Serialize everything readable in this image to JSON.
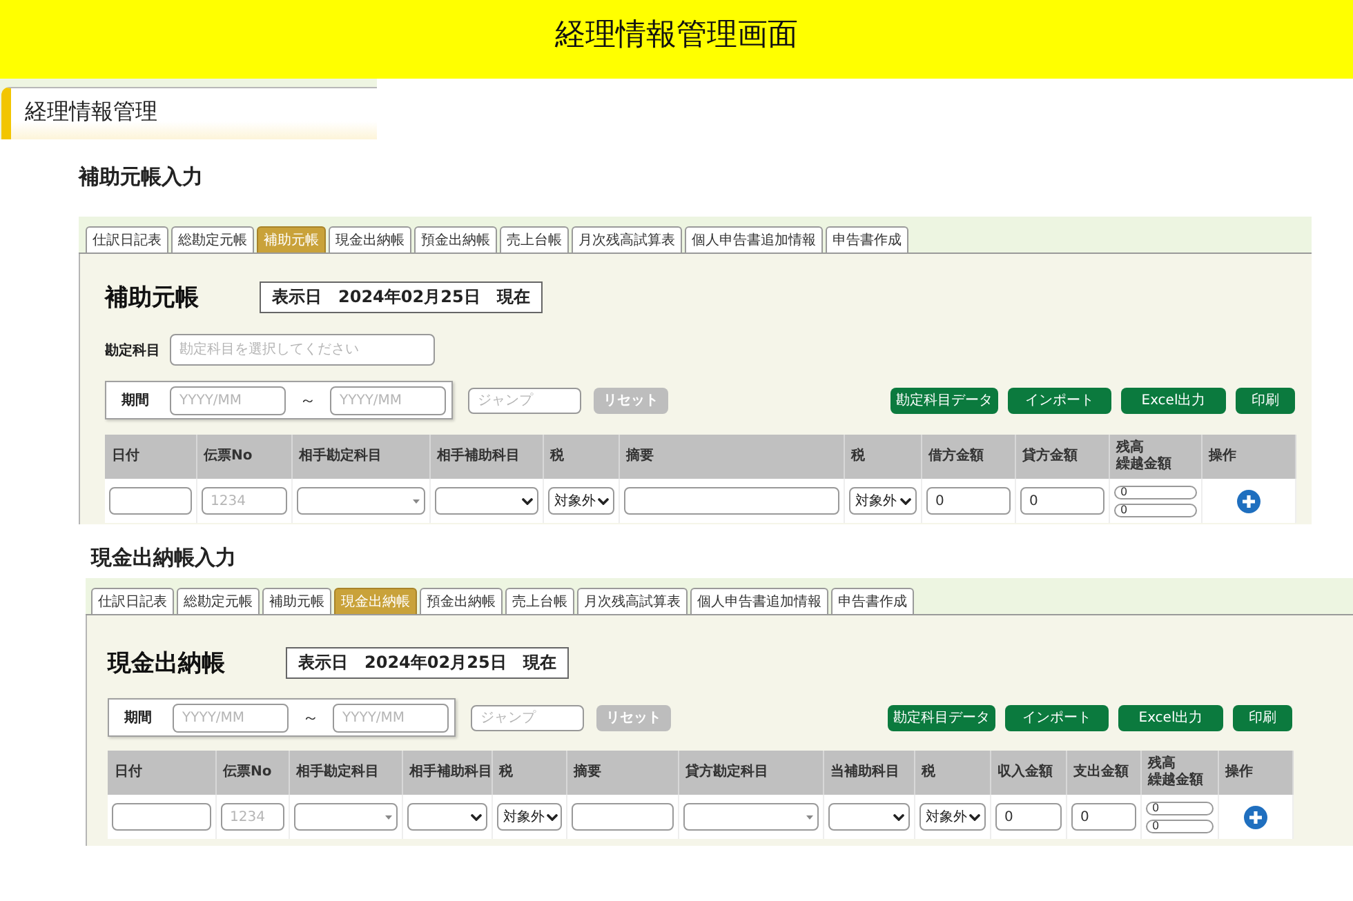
{
  "header": {
    "title": "経理情報管理画面"
  },
  "page_heading": {
    "title": "経理情報管理"
  },
  "sections": [
    {
      "heading": "補助元帳入力",
      "tabs": [
        {
          "label": "仕訳日記表",
          "selected": false
        },
        {
          "label": "総勘定元帳",
          "selected": false
        },
        {
          "label": "補助元帳",
          "selected": true
        },
        {
          "label": "現金出納帳",
          "selected": false
        },
        {
          "label": "預金出納帳",
          "selected": false
        },
        {
          "label": "売上台帳",
          "selected": false
        },
        {
          "label": "月次残高試算表",
          "selected": false
        },
        {
          "label": "個人申告書追加情報",
          "selected": false
        },
        {
          "label": "申告書作成",
          "selected": false
        }
      ],
      "title": "補助元帳",
      "display_date": "表示日　2024年02月25日　現在",
      "account_field": {
        "label": "勘定科目",
        "placeholder": "勘定科目を選択してください"
      },
      "period": {
        "label": "期間",
        "from": {
          "placeholder": "YYYY/MM"
        },
        "separator": "～",
        "to": {
          "placeholder": "YYYY/MM"
        }
      },
      "jump_field": {
        "placeholder": "ジャンプ"
      },
      "reset_button": {
        "label": "リセット",
        "disabled": true
      },
      "action_buttons": [
        "勘定科目データ",
        "インポート",
        "Excel出力",
        "印刷"
      ],
      "table": {
        "columns": [
          "日付",
          "伝票No",
          "相手勘定科目",
          "相手補助科目",
          "税",
          "摘要",
          "税",
          "借方金額",
          "貸方金額",
          "残高繰越金額",
          "操作"
        ],
        "row": [
          {
            "kind": "input"
          },
          {
            "kind": "input",
            "placeholder": "1234"
          },
          {
            "kind": "combo"
          },
          {
            "kind": "select"
          },
          {
            "kind": "select",
            "value": "対象外"
          },
          {
            "kind": "input"
          },
          {
            "kind": "select",
            "value": "対象外"
          },
          {
            "kind": "input",
            "value": "0"
          },
          {
            "kind": "input",
            "value": "0"
          },
          {
            "kind": "pair",
            "values": [
              "0",
              "0"
            ]
          },
          {
            "kind": "add"
          }
        ]
      }
    },
    {
      "heading": "現金出納帳入力",
      "tabs": [
        {
          "label": "仕訳日記表",
          "selected": false
        },
        {
          "label": "総勘定元帳",
          "selected": false
        },
        {
          "label": "補助元帳",
          "selected": false
        },
        {
          "label": "現金出納帳",
          "selected": true
        },
        {
          "label": "預金出納帳",
          "selected": false
        },
        {
          "label": "売上台帳",
          "selected": false
        },
        {
          "label": "月次残高試算表",
          "selected": false
        },
        {
          "label": "個人申告書追加情報",
          "selected": false
        },
        {
          "label": "申告書作成",
          "selected": false
        }
      ],
      "title": "現金出納帳",
      "display_date": "表示日　2024年02月25日　現在",
      "period": {
        "label": "期間",
        "from": {
          "placeholder": "YYYY/MM"
        },
        "separator": "～",
        "to": {
          "placeholder": "YYYY/MM"
        }
      },
      "jump_field": {
        "placeholder": "ジャンプ"
      },
      "reset_button": {
        "label": "リセット",
        "disabled": true
      },
      "action_buttons": [
        "勘定科目データ",
        "インポート",
        "Excel出力",
        "印刷"
      ],
      "table": {
        "columns": [
          "日付",
          "伝票No",
          "相手勘定科目",
          "相手補助科目",
          "税",
          "摘要",
          "貸方勘定科目",
          "当補助科目",
          "税",
          "収入金額",
          "支出金額",
          "残高繰越金額",
          "操作"
        ],
        "row": [
          {
            "kind": "input"
          },
          {
            "kind": "input",
            "placeholder": "1234"
          },
          {
            "kind": "combo"
          },
          {
            "kind": "select"
          },
          {
            "kind": "select",
            "value": "対象外"
          },
          {
            "kind": "input"
          },
          {
            "kind": "combo"
          },
          {
            "kind": "select"
          },
          {
            "kind": "select",
            "value": "対象外"
          },
          {
            "kind": "input",
            "value": "0"
          },
          {
            "kind": "input",
            "value": "0"
          },
          {
            "kind": "pair",
            "values": [
              "0",
              "0"
            ]
          },
          {
            "kind": "add"
          }
        ]
      }
    }
  ]
}
